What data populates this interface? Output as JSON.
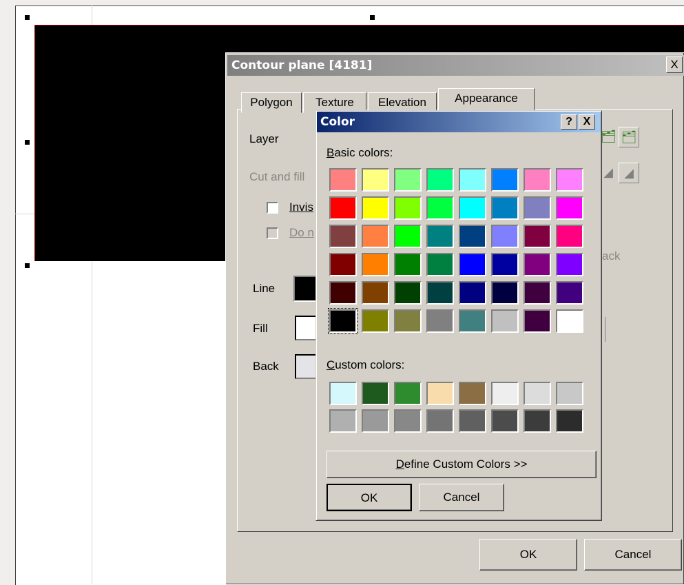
{
  "dialog": {
    "title": "Contour plane [4181]",
    "close_glyph": "X",
    "tabs": [
      "Polygon",
      "Texture",
      "Elevation",
      "Appearance"
    ],
    "active_tab": "Appearance",
    "layer_label": "Layer",
    "cutfill_label": "Cut and fill",
    "invisible_label": "Invis",
    "donot_label": "Do n",
    "back_partial": "ack",
    "line_label": "Line",
    "fill_label": "Fill",
    "back_label": "Back",
    "ok": "OK",
    "cancel": "Cancel"
  },
  "color_dialog": {
    "title": "Color",
    "help_glyph": "?",
    "close_glyph": "X",
    "basic_label": "Basic colors:",
    "custom_label": "Custom colors:",
    "define_button": "Define Custom Colors >>",
    "ok": "OK",
    "cancel": "Cancel",
    "selected": "#000000",
    "basic_colors": [
      [
        "#ff8080",
        "#ffff80",
        "#80ff80",
        "#00ff80",
        "#80ffff",
        "#0080ff",
        "#ff80c0",
        "#ff80ff"
      ],
      [
        "#ff0000",
        "#ffff00",
        "#80ff00",
        "#00ff40",
        "#00ffff",
        "#0080c0",
        "#8080c0",
        "#ff00ff"
      ],
      [
        "#804040",
        "#ff8040",
        "#00ff00",
        "#008080",
        "#004080",
        "#8080ff",
        "#800040",
        "#ff0080"
      ],
      [
        "#800000",
        "#ff8000",
        "#008000",
        "#008040",
        "#0000ff",
        "#0000a0",
        "#800080",
        "#8000ff"
      ],
      [
        "#400000",
        "#804000",
        "#004000",
        "#004040",
        "#000080",
        "#000040",
        "#400040",
        "#400080"
      ],
      [
        "#000000",
        "#808000",
        "#808040",
        "#808080",
        "#408080",
        "#c0c0c0",
        "#400040",
        "#ffffff"
      ]
    ],
    "custom_colors": [
      [
        "#d4f8fc",
        "#1e5a1e",
        "#2e8b2e",
        "#f8dcac",
        "#8c6e44",
        "#eeeeee",
        "#dcdcdc",
        "#c8c8c8"
      ],
      [
        "#b0b0b0",
        "#9a9a9a",
        "#888888",
        "#747474",
        "#606060",
        "#4c4c4c",
        "#3c3c3c",
        "#2c2c2c"
      ]
    ]
  }
}
